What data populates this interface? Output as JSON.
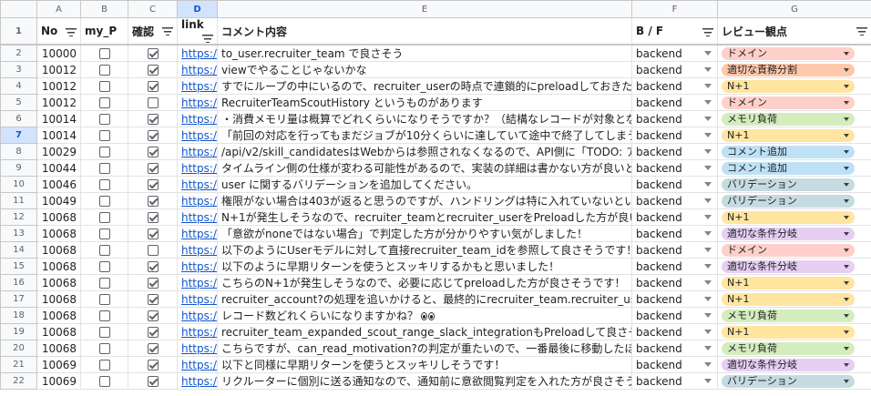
{
  "columns": [
    "A",
    "B",
    "C",
    "D",
    "E",
    "F",
    "G"
  ],
  "selected_column": "D",
  "selected_row": "7",
  "headers": {
    "no": "No",
    "my_p": "my_P",
    "confirm": "確認",
    "link": "link",
    "comment": "コメント内容",
    "bf": "B / F",
    "review": "レビュー観点"
  },
  "header_row_number": "1",
  "chip_colors": {
    "ドメイン": "#ffcfc9",
    "適切な責務分割": "#ffc8aa",
    "N+1": "#ffe5a0",
    "メモリ負荷": "#d4edbc",
    "コメント追加": "#bfe1f6",
    "バリデーション": "#c6dbe1",
    "適切な条件分岐": "#e6cff2"
  },
  "rows": [
    {
      "row": "2",
      "no": "10000",
      "my_p": false,
      "confirm": true,
      "link": "https://g",
      "comment": "to_user.recruiter_team で良さそう",
      "bf": "backend",
      "review": "ドメイン"
    },
    {
      "row": "3",
      "no": "10012",
      "my_p": false,
      "confirm": true,
      "link": "https://g",
      "comment": "viewでやることじゃないかな",
      "bf": "backend",
      "review": "適切な責務分割"
    },
    {
      "row": "4",
      "no": "10012",
      "my_p": false,
      "confirm": true,
      "link": "https://g",
      "comment": "すでにループの中にいるので、recruiter_userの時点で連鎖的にpreloadしておきたい",
      "bf": "backend",
      "review": "N+1"
    },
    {
      "row": "5",
      "no": "10012",
      "my_p": false,
      "confirm": false,
      "link": "https://g",
      "comment": "RecruiterTeamScoutHistory というものがあります",
      "bf": "backend",
      "review": "ドメイン"
    },
    {
      "row": "6",
      "no": "10014",
      "my_p": false,
      "confirm": true,
      "link": "https://g",
      "comment": "・消費メモリ量は概算でどれくらいになりそうですか？（結構なレコードが対象とな",
      "bf": "backend",
      "review": "メモリ負荷"
    },
    {
      "row": "7",
      "no": "10014",
      "my_p": false,
      "confirm": true,
      "link": "https://g",
      "comment": "「前回の対応を行ってもまだジョブが10分くらいに達していて途中で終了してしまう",
      "bf": "backend",
      "review": "N+1"
    },
    {
      "row": "8",
      "no": "10029",
      "my_p": false,
      "confirm": true,
      "link": "https://g",
      "comment": "/api/v2/skill_candidatesはWebからは参照されなくなるので、API側に「TODO: アプ",
      "bf": "backend",
      "review": "コメント追加"
    },
    {
      "row": "9",
      "no": "10044",
      "my_p": false,
      "confirm": true,
      "link": "https://g",
      "comment": "タイムライン側の仕様が変わる可能性があるので、実装の詳細は書かない方が良いと",
      "bf": "backend",
      "review": "コメント追加"
    },
    {
      "row": "10",
      "no": "10046",
      "my_p": false,
      "confirm": true,
      "link": "https://g",
      "comment": "user に関するバリデーションを追加してください。",
      "bf": "backend",
      "review": "バリデーション"
    },
    {
      "row": "11",
      "no": "10049",
      "my_p": false,
      "confirm": true,
      "link": "https://g",
      "comment": "権限がない場合は403が返ると思うのですが、ハンドリングは特に入れていないとい",
      "bf": "backend",
      "review": "バリデーション"
    },
    {
      "row": "12",
      "no": "10068",
      "my_p": false,
      "confirm": true,
      "link": "https://g",
      "comment": "N+1が発生しそうなので、recruiter_teamとrecruiter_userをPreloadした方が良いかも",
      "bf": "backend",
      "review": "N+1"
    },
    {
      "row": "13",
      "no": "10068",
      "my_p": false,
      "confirm": true,
      "link": "https://g",
      "comment": "「意欲がnoneではない場合」で判定した方が分かりやすい気がしました！",
      "bf": "backend",
      "review": "適切な条件分岐"
    },
    {
      "row": "14",
      "no": "10068",
      "my_p": false,
      "confirm": false,
      "link": "https://g",
      "comment": "以下のようにUserモデルに対して直接recruiter_team_idを参照して良さそうです！",
      "bf": "backend",
      "review": "ドメイン"
    },
    {
      "row": "15",
      "no": "10068",
      "my_p": false,
      "confirm": true,
      "link": "https://g",
      "comment": "以下のように早期リターンを使うとスッキリするかもと思いました！",
      "bf": "backend",
      "review": "適切な条件分岐"
    },
    {
      "row": "16",
      "no": "10068",
      "my_p": false,
      "confirm": true,
      "link": "https://g",
      "comment": "こちらのN+1が発生しそうなので、必要に応じてpreloadした方が良さそうです！",
      "bf": "backend",
      "review": "N+1"
    },
    {
      "row": "17",
      "no": "10068",
      "my_p": false,
      "confirm": true,
      "link": "https://g",
      "comment": "recruiter_account?の処理を追いかけると、最終的にrecruiter_team.recruiter_usersに",
      "bf": "backend",
      "review": "N+1"
    },
    {
      "row": "18",
      "no": "10068",
      "my_p": false,
      "confirm": true,
      "link": "https://g",
      "comment": "レコード数どれくらいになりますかね？",
      "eyes": true,
      "bf": "backend",
      "review": "メモリ負荷"
    },
    {
      "row": "19",
      "no": "10068",
      "my_p": false,
      "confirm": true,
      "link": "https://g",
      "comment": "recruiter_team_expanded_scout_range_slack_integrationもPreloadして良さそうです",
      "bf": "backend",
      "review": "N+1"
    },
    {
      "row": "20",
      "no": "10068",
      "my_p": false,
      "confirm": true,
      "link": "https://g",
      "comment": "こちらですが、can_read_motivation?の判定が重たいので、一番最後に移動したほう",
      "bf": "backend",
      "review": "メモリ負荷"
    },
    {
      "row": "21",
      "no": "10069",
      "my_p": false,
      "confirm": true,
      "link": "https://g",
      "comment": "以下と同様に早期リターンを使うとスッキリしそうです！",
      "bf": "backend",
      "review": "適切な条件分岐"
    },
    {
      "row": "22",
      "no": "10069",
      "my_p": false,
      "confirm": true,
      "link": "https://g",
      "comment": "リクルーターに個別に送る通知なので、通知前に意欲閲覧判定を入れた方が良さそう",
      "bf": "backend",
      "review": "バリデーション"
    }
  ]
}
